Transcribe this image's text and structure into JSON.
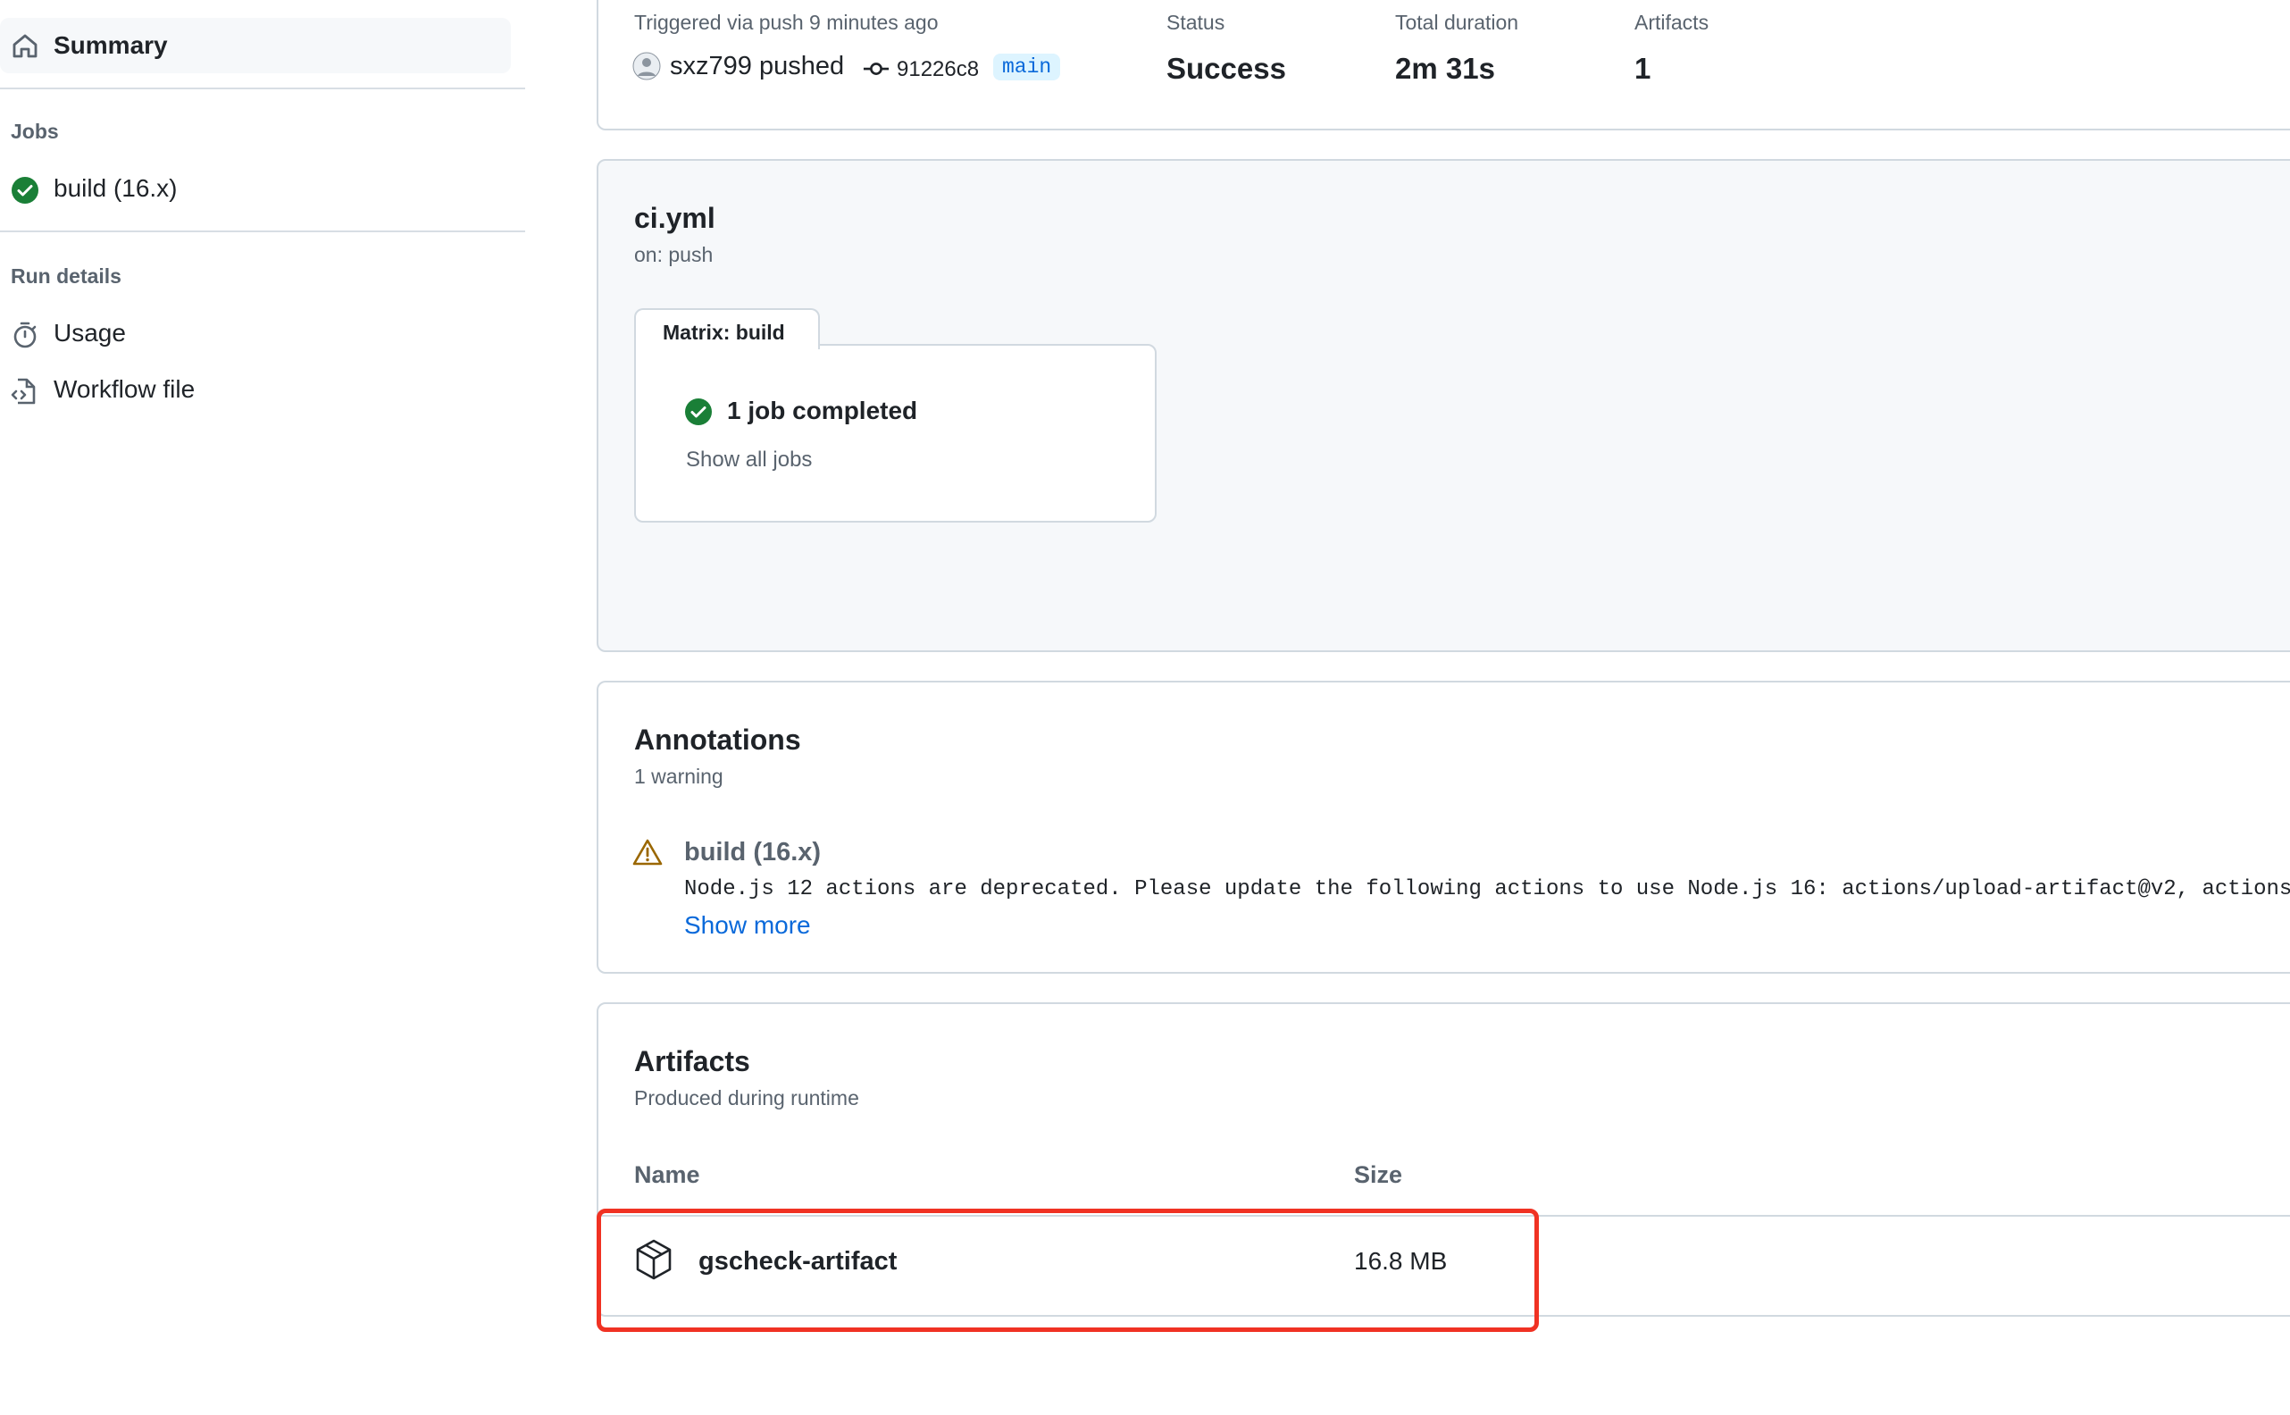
{
  "sidebar": {
    "summary_label": "Summary",
    "jobs_heading": "Jobs",
    "job_item": "build (16.x)",
    "run_details_heading": "Run details",
    "usage_label": "Usage",
    "workflow_file_label": "Workflow file"
  },
  "run_meta": {
    "trigger_text": "Triggered via push 9 minutes ago",
    "actor": "sxz799 pushed",
    "commit": "91226c8",
    "branch": "main",
    "status_label": "Status",
    "status_value": "Success",
    "duration_label": "Total duration",
    "duration_value": "2m 31s",
    "artifacts_label": "Artifacts",
    "artifacts_value": "1"
  },
  "workflow": {
    "file": "ci.yml",
    "trigger": "on: push",
    "matrix_tab": "Matrix: build",
    "jobs_completed": "1 job completed",
    "show_all_jobs": "Show all jobs"
  },
  "annotations": {
    "title": "Annotations",
    "subtitle": "1 warning",
    "items": [
      {
        "title": "build (16.x)",
        "message": "Node.js 12 actions are deprecated. Please update the following actions to use Node.js 16: actions/upload-artifact@v2, actions",
        "show_more": "Show more"
      }
    ]
  },
  "artifacts": {
    "title": "Artifacts",
    "subtitle": "Produced during runtime",
    "col_name": "Name",
    "col_size": "Size",
    "rows": [
      {
        "name": "gscheck-artifact",
        "size": "16.8 MB"
      }
    ]
  },
  "colors": {
    "success": "#1a7f37",
    "warning": "#9a6700",
    "link": "#0969da",
    "highlight": "#f03223"
  }
}
